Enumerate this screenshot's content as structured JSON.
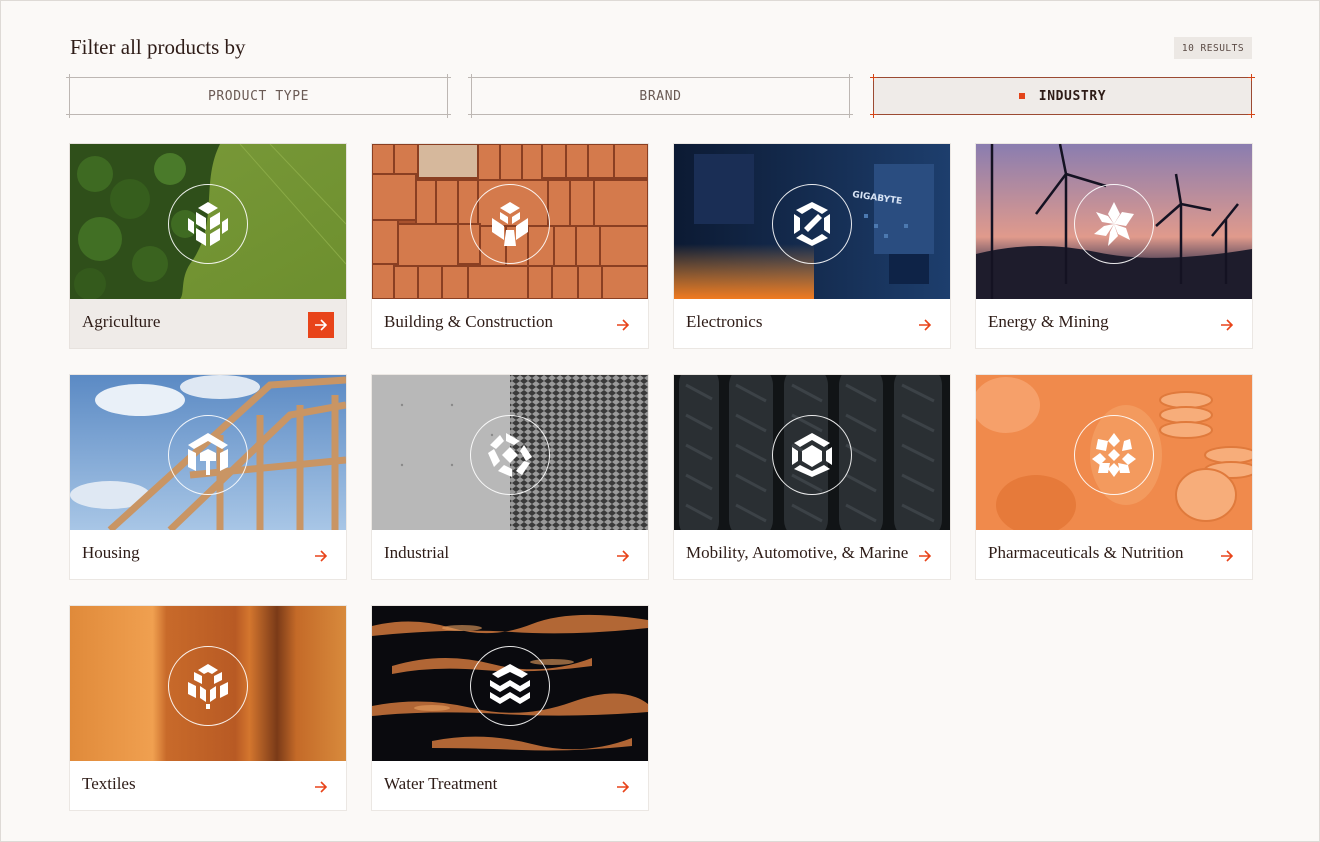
{
  "header": {
    "title": "Filter all products by",
    "results_label": "10 RESULTS"
  },
  "filters": {
    "tabs": [
      {
        "label": "PRODUCT TYPE",
        "active": false
      },
      {
        "label": "BRAND",
        "active": false
      },
      {
        "label": "INDUSTRY",
        "active": true
      }
    ]
  },
  "industries": [
    {
      "label": "Agriculture",
      "active": true,
      "icon": "agriculture-emblem-icon"
    },
    {
      "label": "Building & Construction",
      "active": false,
      "icon": "construction-emblem-icon"
    },
    {
      "label": "Electronics",
      "active": false,
      "icon": "electronics-emblem-icon",
      "image_text": "GIGABYTE"
    },
    {
      "label": "Energy & Mining",
      "active": false,
      "icon": "energy-emblem-icon"
    },
    {
      "label": "Housing",
      "active": false,
      "icon": "housing-emblem-icon"
    },
    {
      "label": "Industrial",
      "active": false,
      "icon": "industrial-emblem-icon"
    },
    {
      "label": "Mobility, Automotive, & Marine",
      "active": false,
      "icon": "mobility-emblem-icon"
    },
    {
      "label": "Pharmaceuticals & Nutrition",
      "active": false,
      "icon": "pharma-emblem-icon"
    },
    {
      "label": "Textiles",
      "active": false,
      "icon": "textiles-emblem-icon"
    },
    {
      "label": "Water Treatment",
      "active": false,
      "icon": "water-emblem-icon"
    }
  ],
  "colors": {
    "accent": "#e8441a",
    "page_bg": "#fbf9f7",
    "text": "#2e1c17"
  }
}
